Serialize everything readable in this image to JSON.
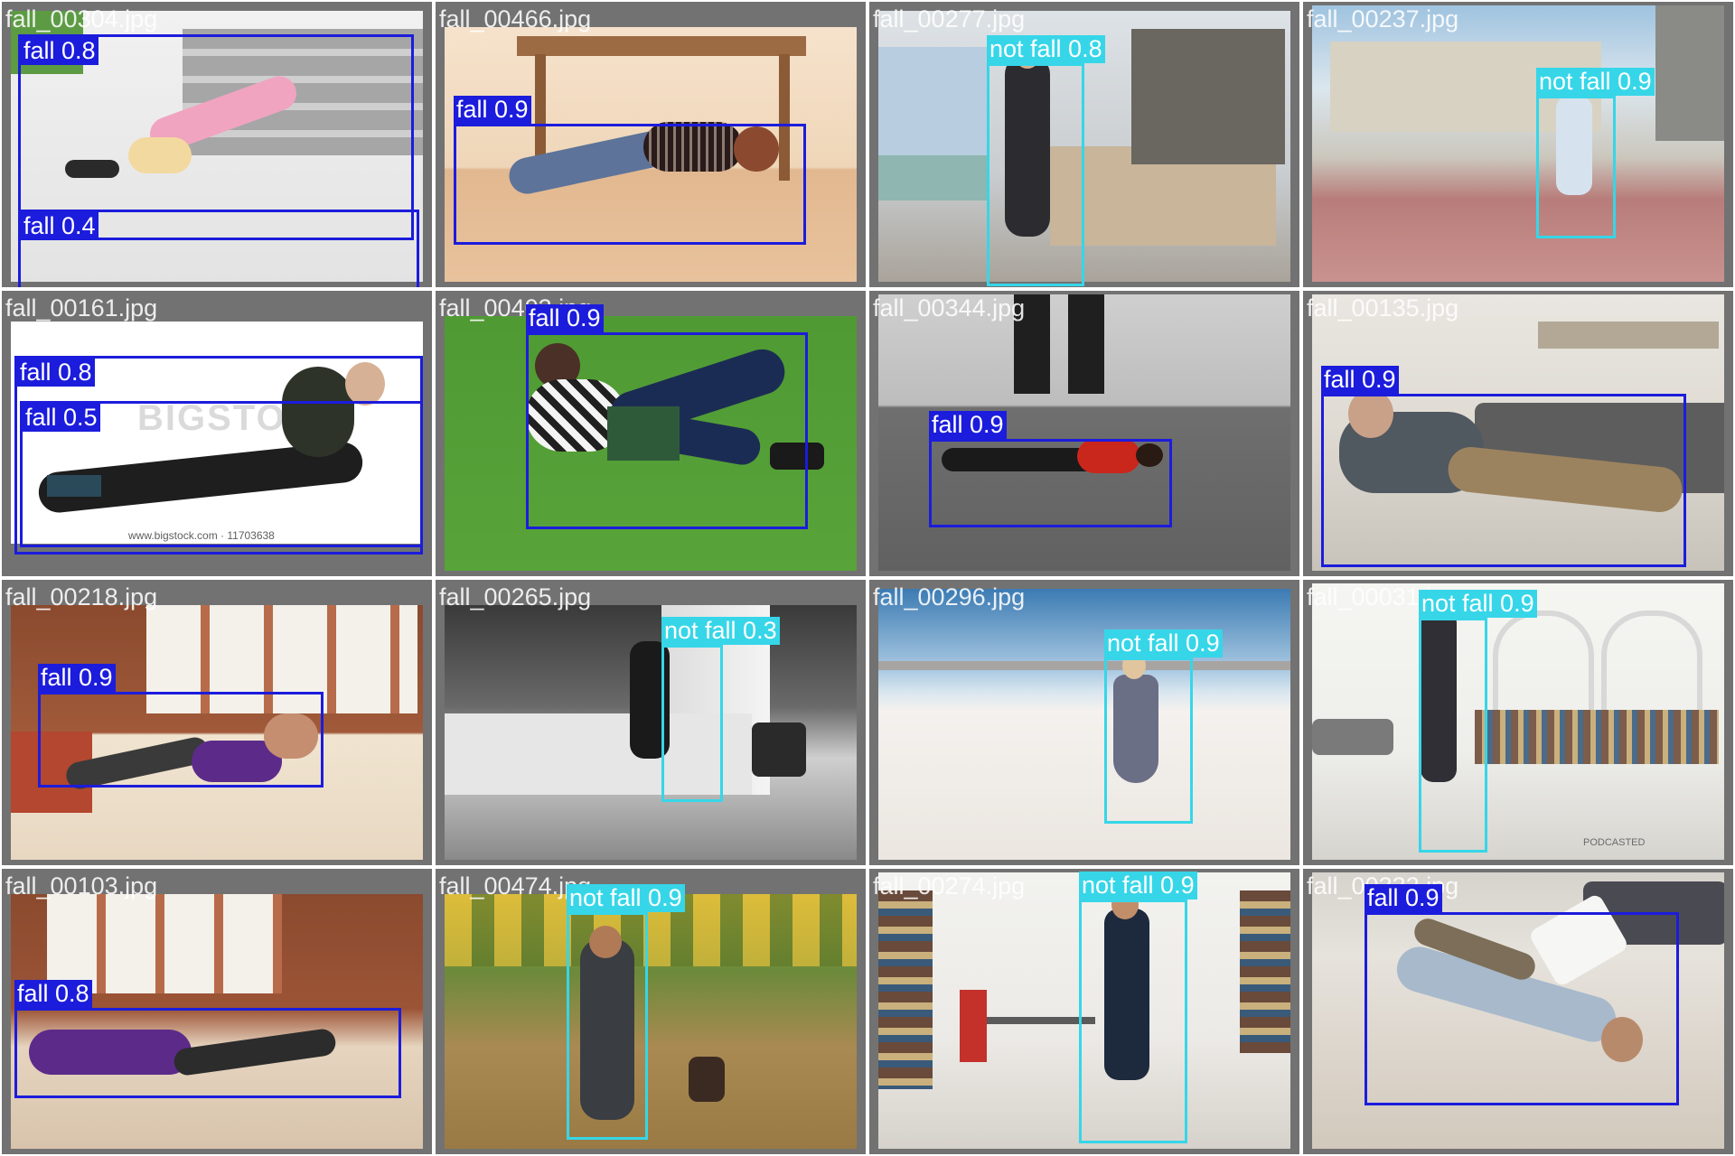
{
  "tiles": [
    {
      "file": "fall_00304.jpg",
      "detections": [
        {
          "label": "fall 0.8",
          "cls": "fall"
        },
        {
          "label": "fall 0.4",
          "cls": "fall"
        }
      ]
    },
    {
      "file": "fall_00466.jpg",
      "detections": [
        {
          "label": "fall 0.9",
          "cls": "fall"
        }
      ]
    },
    {
      "file": "fall_00277.jpg",
      "detections": [
        {
          "label": "not fall 0.8",
          "cls": "not fall"
        }
      ]
    },
    {
      "file": "fall_00237.jpg",
      "detections": [
        {
          "label": "not fall 0.9",
          "cls": "not fall"
        }
      ]
    },
    {
      "file": "fall_00161.jpg",
      "detections": [
        {
          "label": "fall 0.8",
          "cls": "fall"
        },
        {
          "label": "fall 0.5",
          "cls": "fall"
        }
      ],
      "watermark": "BIGSTOCK",
      "watermark_url": "www.bigstock.com · 11703638"
    },
    {
      "file": "fall_00403.jpg",
      "detections": [
        {
          "label": "fall 0.9",
          "cls": "fall"
        }
      ]
    },
    {
      "file": "fall_00344.jpg",
      "detections": [
        {
          "label": "fall 0.9",
          "cls": "fall"
        }
      ]
    },
    {
      "file": "fall_00135.jpg",
      "detections": [
        {
          "label": "fall 0.9",
          "cls": "fall"
        }
      ]
    },
    {
      "file": "fall_00218.jpg",
      "detections": [
        {
          "label": "fall 0.9",
          "cls": "fall"
        }
      ]
    },
    {
      "file": "fall_00265.jpg",
      "detections": [
        {
          "label": "not fall 0.3",
          "cls": "not fall"
        }
      ]
    },
    {
      "file": "fall_00296.jpg",
      "detections": [
        {
          "label": "not fall 0.9",
          "cls": "not fall"
        }
      ]
    },
    {
      "file": "fall_00031.jpg",
      "detections": [
        {
          "label": "not fall 0.9",
          "cls": "not fall"
        }
      ],
      "watermark": "PODCASTED"
    },
    {
      "file": "fall_00103.jpg",
      "detections": [
        {
          "label": "fall 0.8",
          "cls": "fall"
        }
      ]
    },
    {
      "file": "fall_00474.jpg",
      "detections": [
        {
          "label": "not fall 0.9",
          "cls": "not fall"
        }
      ]
    },
    {
      "file": "fall_00274.jpg",
      "detections": [
        {
          "label": "not fall 0.9",
          "cls": "not fall"
        }
      ]
    },
    {
      "file": "fall_00332.jpg",
      "detections": [
        {
          "label": "fall 0.9",
          "cls": "fall"
        }
      ]
    }
  ],
  "colors": {
    "fall": "#1c1cdc",
    "not_fall": "#36d6e8",
    "tile_background": "#727272"
  }
}
